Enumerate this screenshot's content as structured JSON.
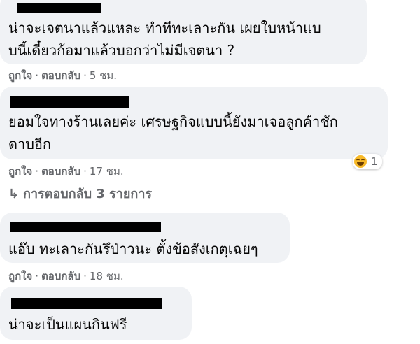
{
  "comments": [
    {
      "lines": [
        "น่าจะเจตนาแล้วแหละ ทำทีทะเลาะกัน เผยใบหน้าแบ",
        "บนี้เดี๋ยวก้อมาแล้วบอกว่าไม่มีเจตนา ?"
      ],
      "like_label": "ถูกใจ",
      "reply_label": "ตอบกลับ",
      "time": "5 ชม."
    },
    {
      "lines": [
        "ยอมใจทางร้านเลยค่ะ เศรษฐกิจแบบนี้ยังมาเจอลูกค้าชัก",
        "ดาบอีก"
      ],
      "like_label": "ถูกใจ",
      "reply_label": "ตอบกลับ",
      "time": "17 ชม.",
      "reaction_count": "1"
    },
    {
      "lines": [
        "แอ๊บ ทะเลาะกันรึป่าวนะ ตั้งข้อสังเกตุเฉยๆ"
      ],
      "like_label": "ถูกใจ",
      "reply_label": "ตอบกลับ",
      "time": "18 ชม."
    },
    {
      "lines": [
        "น่าจะเป็นแผนกินฟรี"
      ]
    }
  ],
  "view_replies": "การตอบกลับ 3 รายการ",
  "separator": "·",
  "icons": {
    "reaction": "laughing-emoji-icon",
    "reply_arrow": "reply-arrow-icon"
  }
}
